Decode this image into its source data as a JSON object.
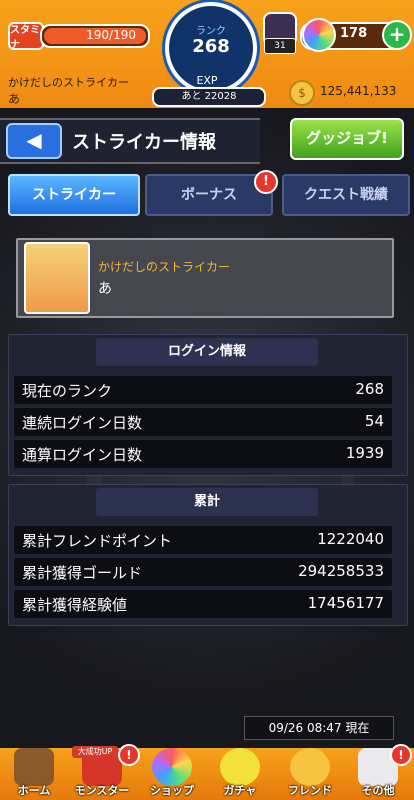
{
  "header": {
    "stamina_label": "スタミナ",
    "stamina": "190/190",
    "stamina_fraction": 1.0,
    "rank_label": "ランク",
    "rank_value": "268",
    "exp_label": "EXP",
    "exp_remaining": "あと 22028",
    "gem_count": "31",
    "orb_count": "178",
    "plus_label": "+",
    "user_name": "かけだしのストライカー",
    "user_sub": "あ",
    "gold_value": "125,441,133"
  },
  "titlebar": {
    "back_label": "◀",
    "title": "ストライカー情報",
    "action_label": "グッジョブ!"
  },
  "tabs": [
    {
      "label": "ストライカー",
      "active": true
    },
    {
      "label": "ボーナス",
      "active": false
    },
    {
      "label": "クエスト戦績",
      "active": false
    }
  ],
  "tab_badge": "!",
  "profile": {
    "name": "かけだしのストライカー",
    "sub": "あ"
  },
  "login_section": {
    "title": "ログイン情報",
    "rows": [
      {
        "label": "現在のランク",
        "value": "268"
      },
      {
        "label": "連続ログイン日数",
        "value": "54"
      },
      {
        "label": "通算ログイン日数",
        "value": "1939"
      }
    ]
  },
  "total_section": {
    "title": "累計",
    "rows": [
      {
        "label": "累計フレンドポイント",
        "value": "1222040"
      },
      {
        "label": "累計獲得ゴールド",
        "value": "294258533"
      },
      {
        "label": "累計獲得経験値",
        "value": "17456177"
      }
    ]
  },
  "timestamp": "09/26 08:47 現在",
  "nav": {
    "items": [
      {
        "label": "ホーム",
        "icon": "home-icon"
      },
      {
        "label": "モンスター",
        "icon": "monster-icon"
      },
      {
        "label": "ショップ",
        "icon": "shop-icon"
      },
      {
        "label": "ガチャ",
        "icon": "gacha-icon"
      },
      {
        "label": "フレンド",
        "icon": "friend-icon"
      },
      {
        "label": "その他",
        "icon": "other-icon"
      }
    ],
    "bonus_tag": "大成功UP",
    "badge": "!"
  },
  "colors": {
    "header_orange": "#f7a21b",
    "tab_active_blue": "#1f6fe0",
    "panel_bg": "#202433",
    "badge_red": "#e8362a"
  }
}
